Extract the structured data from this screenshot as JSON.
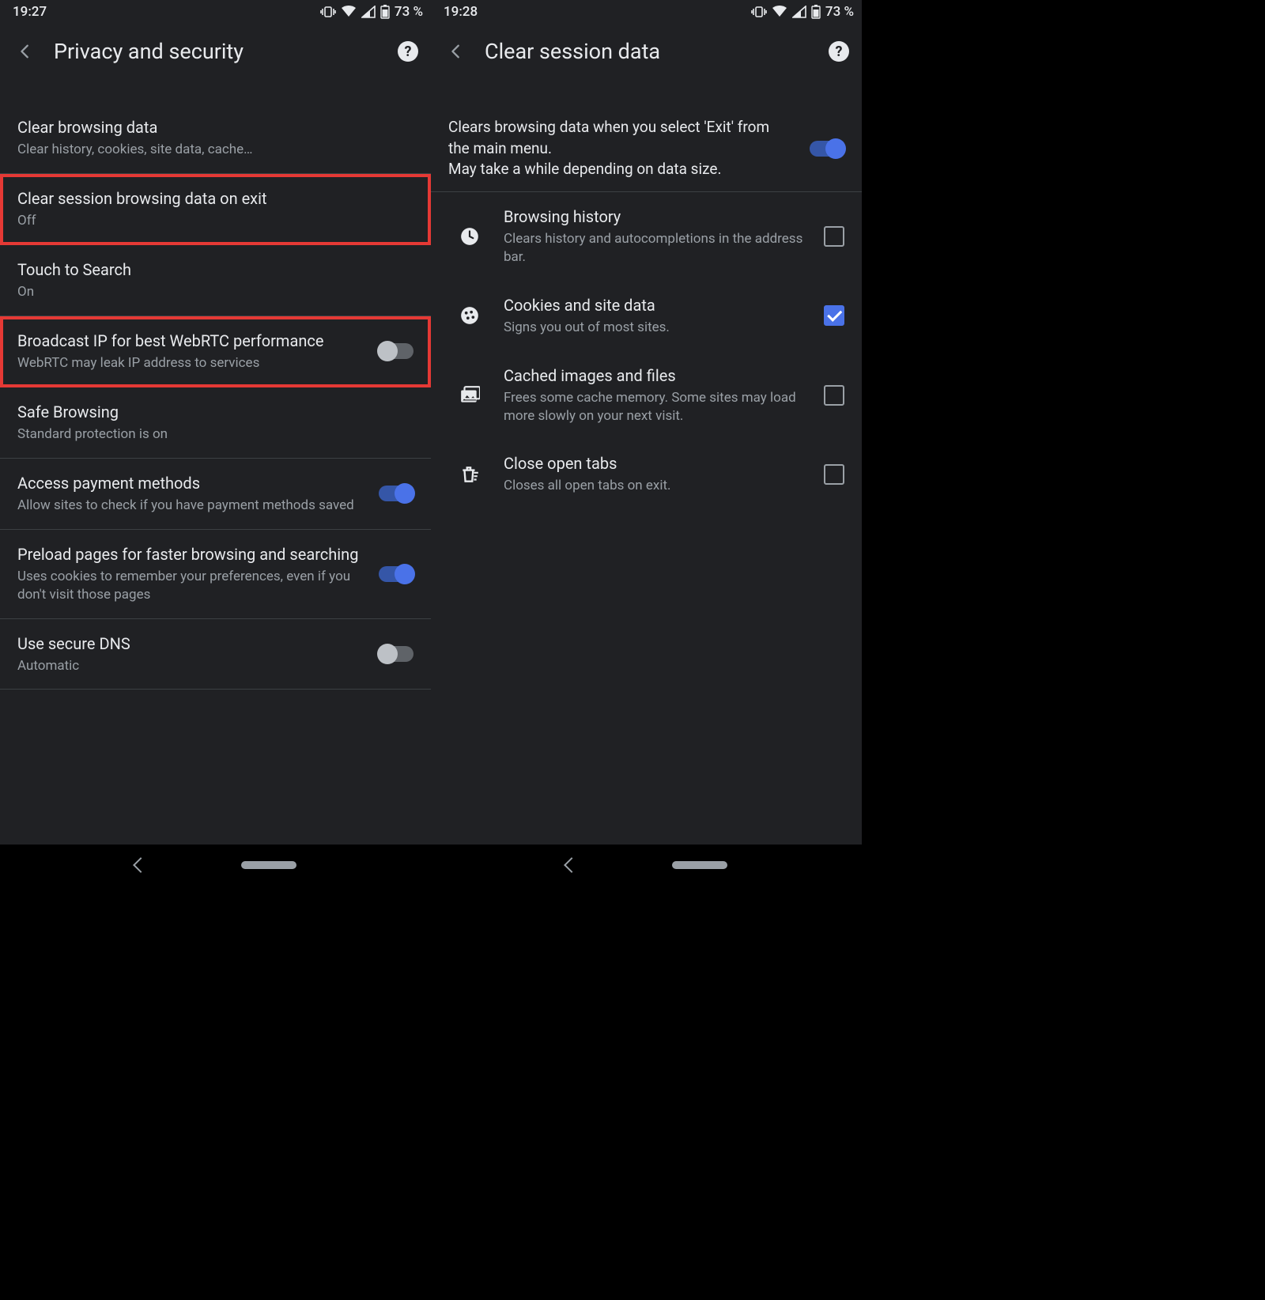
{
  "statusbar": {
    "battery": "73 %"
  },
  "left": {
    "time": "19:27",
    "title": "Privacy and security",
    "rows": {
      "clear_data": {
        "title": "Clear browsing data",
        "sub": "Clear history, cookies, site data, cache…"
      },
      "clear_exit": {
        "title": "Clear session browsing data on exit",
        "sub": "Off"
      },
      "touch": {
        "title": "Touch to Search",
        "sub": "On"
      },
      "webrtc": {
        "title": "Broadcast IP for best WebRTC performance",
        "sub": "WebRTC may leak IP address to services"
      },
      "safe": {
        "title": "Safe Browsing",
        "sub": "Standard protection is on"
      },
      "payment": {
        "title": "Access payment methods",
        "sub": "Allow sites to check if you have payment methods saved"
      },
      "preload": {
        "title": "Preload pages for faster browsing and searching",
        "sub": "Uses cookies to remember your preferences, even if you don't visit those pages"
      },
      "dns": {
        "title": "Use secure DNS",
        "sub": "Automatic"
      }
    }
  },
  "right": {
    "time": "19:28",
    "title": "Clear session data",
    "intro": "Clears browsing data when you select 'Exit' from the main menu.\nMay take a while depending on data size.",
    "items": {
      "history": {
        "title": "Browsing history",
        "sub": "Clears history and autocompletions in the address bar."
      },
      "cookies": {
        "title": "Cookies and site data",
        "sub": "Signs you out of most sites."
      },
      "cache": {
        "title": "Cached images and files",
        "sub": "Frees some cache memory. Some sites may load more slowly on your next visit."
      },
      "tabs": {
        "title": "Close open tabs",
        "sub": "Closes all open tabs on exit."
      }
    }
  }
}
